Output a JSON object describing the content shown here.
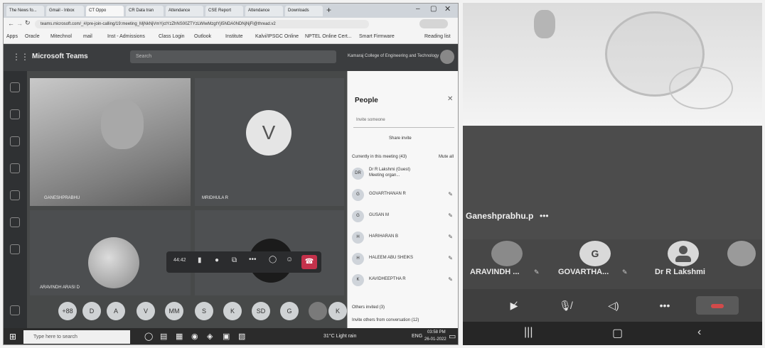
{
  "browser": {
    "tabs": [
      "The News fo...",
      "Gmail - Inbox",
      "CT Oppo",
      "CR Data tran",
      "Attendance",
      "CSE Report",
      "Attendance",
      "Downloads"
    ],
    "url": "teams.microsoft.com/_#/pre-join-calling/19:meeting_MjNkNjVmYjctYzZhNS00ZTYzLWIwMzgtYjI5NDA0NDNjNjFl@thread.v2",
    "bookmarks": [
      "Apps",
      "Oracle",
      "Mitechnol",
      "mail",
      "Inst - Admissions",
      "Class Login",
      "Outlook",
      "Institute",
      "Kalvi/IPSGC Online",
      "NPTEL Online Cert...",
      "Smart Firmware",
      "Reading list"
    ]
  },
  "teams": {
    "app_name": "Microsoft Teams",
    "search_placeholder": "Search",
    "org_name": "Kamaraj College of Engineering and Technology",
    "tile_label_1": "GANESHPRABHU",
    "tile_v_letter": "V",
    "tile_v_name": "MRIDHULA R",
    "tile_photo_label": "ARAVINDH ARASI D",
    "call_timer": "44:42",
    "bubbles": [
      "+88",
      "D",
      "A",
      "V",
      "MM",
      "S",
      "K",
      "SD",
      "G",
      "",
      "K"
    ]
  },
  "people": {
    "title": "People",
    "invite_placeholder": "Invite someone",
    "share_invite": "Share invite",
    "section_label": "Currently in this meeting (43)",
    "mute_all": "Mute all",
    "participants": [
      {
        "initials": "DR",
        "name": "Dr R Lakshmi (Guest)",
        "sub": "Meeting organ..."
      },
      {
        "initials": "G",
        "name": "GOVARTHANAN R"
      },
      {
        "initials": "G",
        "name": "GUSAN M"
      },
      {
        "initials": "H",
        "name": "HARIHARAN B"
      },
      {
        "initials": "H",
        "name": "HALEEM ABU SHEIKS"
      },
      {
        "initials": "K",
        "name": "KAVIDHEEPTHA R"
      }
    ],
    "others": "Others invited (3)",
    "invite_others": "Invite others from conversation (12)"
  },
  "taskbar": {
    "search_placeholder": "Type here to search",
    "weather": "31°C Light rain",
    "lang": "ENG",
    "time": "03:58 PM",
    "date": "26-01-2022"
  },
  "phone": {
    "featured_name": "Ganeshprabhu.p",
    "more_dots": "•••",
    "thumbs": [
      {
        "label": "ARAVINDH ...",
        "letter": "",
        "color": "#8a8a8a"
      },
      {
        "label": "GOVARTHA...",
        "letter": "G",
        "color": "#d9d9d9"
      },
      {
        "label": "Dr R Lakshmi",
        "letter": "",
        "color": "#d9d9d9"
      }
    ],
    "controls": [
      "video-off",
      "mic-off",
      "speaker",
      "more",
      "hang-up"
    ]
  }
}
